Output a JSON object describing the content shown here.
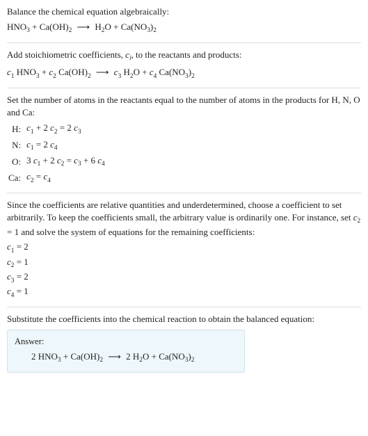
{
  "intro": {
    "line1": "Balance the chemical equation algebraically:"
  },
  "eq1": {
    "hno3": "HNO",
    "hno3_sub": "3",
    "plus1": " + ",
    "caoh": "Ca(OH)",
    "caoh_sub": "2",
    "arrow": "⟶",
    "h2o_a": "H",
    "h2o_sub1": "2",
    "h2o_b": "O",
    "plus2": " + ",
    "cano3": "Ca(NO",
    "cano3_sub1": "3",
    "cano3_b": ")",
    "cano3_sub2": "2"
  },
  "step2_text": "Add stoichiometric coefficients, ",
  "step2_ci": "c",
  "step2_ci_sub": "i",
  "step2_text_b": ", to the reactants and products:",
  "eq2": {
    "c1": "c",
    "c1s": "1",
    "sp1": " ",
    "hno3": "HNO",
    "hno3_sub": "3",
    "plus1": " + ",
    "c2": "c",
    "c2s": "2",
    "sp2": " ",
    "caoh": "Ca(OH)",
    "caoh_sub": "2",
    "arrow": "⟶",
    "c3": "c",
    "c3s": "3",
    "sp3": " ",
    "h2o_a": "H",
    "h2o_sub1": "2",
    "h2o_b": "O",
    "plus2": " + ",
    "c4": "c",
    "c4s": "4",
    "sp4": " ",
    "cano3": "Ca(NO",
    "cano3_sub1": "3",
    "cano3_b": ")",
    "cano3_sub2": "2"
  },
  "step3_text": "Set the number of atoms in the reactants equal to the number of atoms in the products for H, N, O and Ca:",
  "atoms": {
    "H_lab": "H:",
    "N_lab": "N:",
    "O_lab": "O:",
    "Ca_lab": "Ca:",
    "H_eq_a": "c",
    "H_eq_as": "1",
    "H_eq_b": " + 2 ",
    "H_eq_c": "c",
    "H_eq_cs": "2",
    "H_eq_d": " = 2 ",
    "H_eq_e": "c",
    "H_eq_es": "3",
    "N_eq_a": "c",
    "N_eq_as": "1",
    "N_eq_b": " = 2 ",
    "N_eq_c": "c",
    "N_eq_cs": "4",
    "O_eq_a": "3 ",
    "O_eq_b": "c",
    "O_eq_bs": "1",
    "O_eq_c": " + 2 ",
    "O_eq_d": "c",
    "O_eq_ds": "2",
    "O_eq_e": " = ",
    "O_eq_f": "c",
    "O_eq_fs": "3",
    "O_eq_g": " + 6 ",
    "O_eq_h": "c",
    "O_eq_hs": "4",
    "Ca_eq_a": "c",
    "Ca_eq_as": "2",
    "Ca_eq_b": " = ",
    "Ca_eq_c": "c",
    "Ca_eq_cs": "4"
  },
  "step4_a": "Since the coefficients are relative quantities and underdetermined, choose a coefficient to set arbitrarily. To keep the coefficients small, the arbitrary value is ordinarily one. For instance, set ",
  "step4_c2": "c",
  "step4_c2s": "2",
  "step4_b": " = 1 and solve the system of equations for the remaining coefficients:",
  "sol": {
    "l1a": "c",
    "l1s": "1",
    "l1b": " = 2",
    "l2a": "c",
    "l2s": "2",
    "l2b": " = 1",
    "l3a": "c",
    "l3s": "3",
    "l3b": " = 2",
    "l4a": "c",
    "l4s": "4",
    "l4b": " = 1"
  },
  "step5_text": "Substitute the coefficients into the chemical reaction to obtain the balanced equation:",
  "answer_label": "Answer:",
  "answer_eq": {
    "a1": "2 ",
    "hno3": "HNO",
    "hno3_sub": "3",
    "plus1": " + ",
    "caoh": "Ca(OH)",
    "caoh_sub": "2",
    "arrow": "⟶",
    "a2": "2 ",
    "h2o_a": "H",
    "h2o_sub1": "2",
    "h2o_b": "O",
    "plus2": " + ",
    "cano3": "Ca(NO",
    "cano3_sub1": "3",
    "cano3_b": ")",
    "cano3_sub2": "2"
  },
  "chart_data": {
    "type": "table",
    "title": "Balancing HNO3 + Ca(OH)2 → H2O + Ca(NO3)2",
    "atom_balance": [
      {
        "element": "H",
        "equation": "c1 + 2 c2 = 2 c3"
      },
      {
        "element": "N",
        "equation": "c1 = 2 c4"
      },
      {
        "element": "O",
        "equation": "3 c1 + 2 c2 = c3 + 6 c4"
      },
      {
        "element": "Ca",
        "equation": "c2 = c4"
      }
    ],
    "solution": {
      "c1": 2,
      "c2": 1,
      "c3": 2,
      "c4": 1
    },
    "balanced_equation": "2 HNO3 + Ca(OH)2 → 2 H2O + Ca(NO3)2"
  }
}
